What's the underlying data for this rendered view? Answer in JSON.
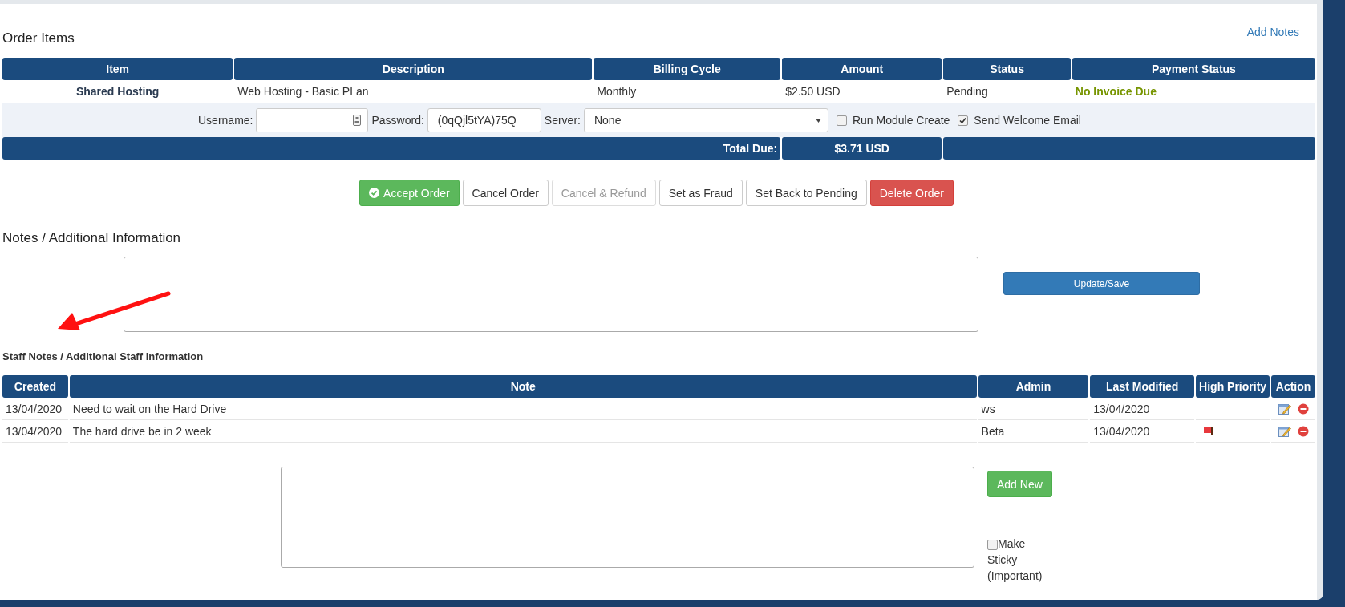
{
  "order_items": {
    "title": "Order Items",
    "add_notes_link": "Add Notes",
    "columns": [
      "Item",
      "Description",
      "Billing Cycle",
      "Amount",
      "Status",
      "Payment Status"
    ],
    "rows": [
      {
        "item": "Shared Hosting",
        "description": "Web Hosting - Basic PLan",
        "billing_cycle": "Monthly",
        "amount": "$2.50 USD",
        "status": "Pending",
        "payment_status": "No Invoice Due"
      }
    ],
    "provisioning": {
      "username_label": "Username:",
      "password_label": "Password:",
      "password_value": "(0qQjl5tYA)75Q",
      "server_label": "Server:",
      "server_value": "None",
      "options": [
        {
          "label": "Run Module Create",
          "checked": false
        },
        {
          "label": "Send Welcome Email",
          "checked": true
        }
      ]
    },
    "total": {
      "label": "Total Due:",
      "value": "$3.71 USD"
    }
  },
  "actions": [
    {
      "label": "Accept Order",
      "kind": "success",
      "disabled": false
    },
    {
      "label": "Cancel Order",
      "kind": "default",
      "disabled": false
    },
    {
      "label": "Cancel & Refund",
      "kind": "default",
      "disabled": true
    },
    {
      "label": "Set as Fraud",
      "kind": "default",
      "disabled": false
    },
    {
      "label": "Set Back to Pending",
      "kind": "default",
      "disabled": false
    },
    {
      "label": "Delete Order",
      "kind": "danger",
      "disabled": false
    }
  ],
  "notes": {
    "title": "Notes / Additional Information",
    "button": "Update/Save"
  },
  "staff_notes": {
    "title": "Staff Notes / Additional Staff Information",
    "columns": [
      "Created",
      "Note",
      "Admin",
      "Last Modified",
      "High Priority",
      "Action"
    ],
    "rows": [
      {
        "created": "13/04/2020",
        "note": "Need to wait on the Hard Drive",
        "admin": "ws",
        "last_modified": "13/04/2020",
        "high_priority": false
      },
      {
        "created": "13/04/2020",
        "note": "The hard drive be in 2 week",
        "admin": "Beta",
        "last_modified": "13/04/2020",
        "high_priority": true
      }
    ],
    "add_button": "Add New",
    "sticky": {
      "label": "Make Sticky (Important)",
      "checked": false
    }
  }
}
